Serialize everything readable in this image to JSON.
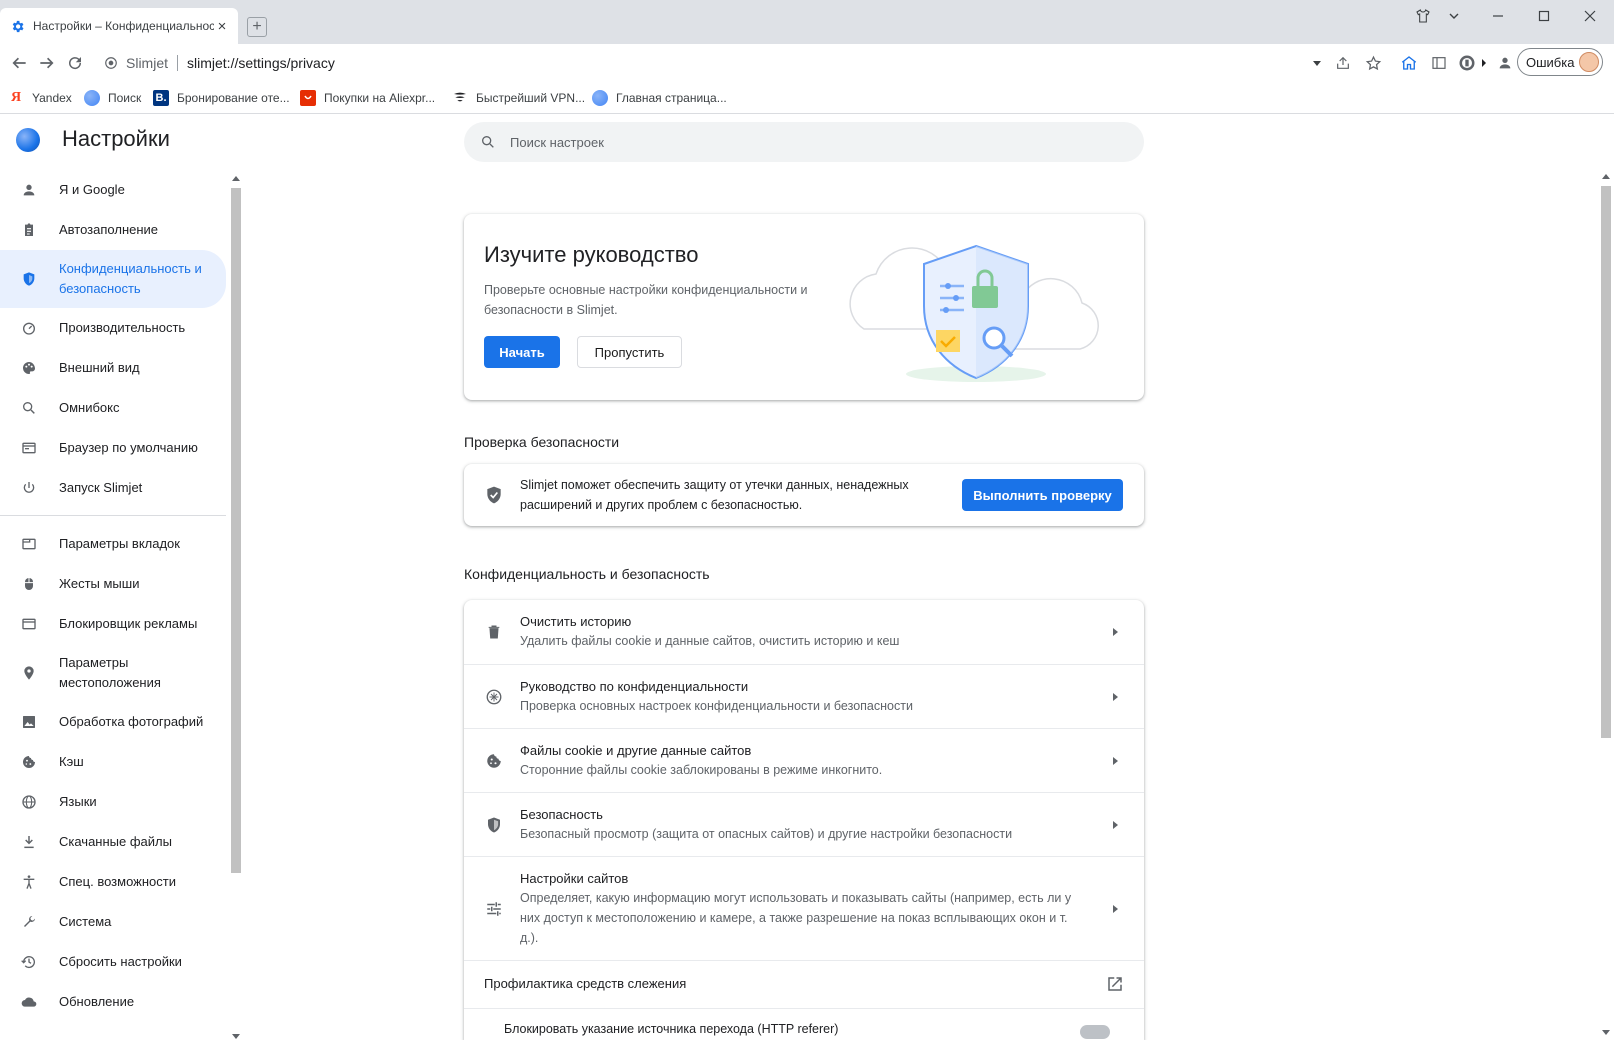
{
  "tab": {
    "title": "Настройки – Конфиденциальность",
    "close": "×",
    "new_tab": "+"
  },
  "toolbar": {
    "site_name": "Slimjet",
    "url": "slimjet://settings/privacy",
    "error_label": "Ошибка"
  },
  "bookmarks": [
    {
      "label": "Yandex",
      "icon": "yandex-icon",
      "color": "#ffffff"
    },
    {
      "label": "Поиск",
      "icon": "globe-icon",
      "color": "#4285f4"
    },
    {
      "label": "Бронирование оте...",
      "icon": "booking-icon",
      "color": "#003580",
      "letter": "B."
    },
    {
      "label": "Покупки на Aliexpr...",
      "icon": "aliexpress-icon",
      "color": "#e62e04"
    },
    {
      "label": "Быстрейший VPN...",
      "icon": "vpn-icon",
      "color": "#202124"
    },
    {
      "label": "Главная страница...",
      "icon": "globe-icon",
      "color": "#4285f4"
    }
  ],
  "header": {
    "title": "Настройки"
  },
  "search": {
    "placeholder": "Поиск настроек"
  },
  "sidebar": {
    "items": [
      {
        "label": "Я и Google",
        "icon": "person-icon"
      },
      {
        "label": "Автозаполнение",
        "icon": "clipboard-icon"
      },
      {
        "label": "Конфиденциальность и безопасность",
        "icon": "shield-icon",
        "active": true
      },
      {
        "label": "Производительность",
        "icon": "speedometer-icon"
      },
      {
        "label": "Внешний вид",
        "icon": "palette-icon"
      },
      {
        "label": "Омнибокс",
        "icon": "search-icon"
      },
      {
        "label": "Браузер по умолчанию",
        "icon": "browser-icon"
      },
      {
        "label": "Запуск Slimjet",
        "icon": "power-icon"
      },
      {
        "label": "Параметры вкладок",
        "icon": "tabs-icon"
      },
      {
        "label": "Жесты мыши",
        "icon": "mouse-icon"
      },
      {
        "label": "Блокировщик рекламы",
        "icon": "adblock-icon"
      },
      {
        "label": "Параметры местоположения",
        "icon": "location-icon"
      },
      {
        "label": "Обработка фотографий",
        "icon": "image-icon"
      },
      {
        "label": "Кэш",
        "icon": "cookie-icon"
      },
      {
        "label": "Языки",
        "icon": "globe-icon"
      },
      {
        "label": "Скачанные файлы",
        "icon": "download-icon"
      },
      {
        "label": "Спец. возможности",
        "icon": "accessibility-icon"
      },
      {
        "label": "Система",
        "icon": "wrench-icon"
      },
      {
        "label": "Сбросить настройки",
        "icon": "history-icon"
      },
      {
        "label": "Обновление",
        "icon": "cloud-icon"
      }
    ]
  },
  "guide": {
    "title": "Изучите руководство",
    "description": "Проверьте основные настройки конфиденциальности и безопасности в Slimjet.",
    "start_label": "Начать",
    "skip_label": "Пропустить"
  },
  "safety_check": {
    "section_title": "Проверка безопасности",
    "description": "Slimjet поможет обеспечить защиту от утечки данных, ненадежных расширений и других проблем с безопасностью.",
    "button_label": "Выполнить проверку"
  },
  "privacy": {
    "section_title": "Конфиденциальность и безопасность",
    "rows": [
      {
        "title": "Очистить историю",
        "subtitle": "Удалить файлы cookie и данные сайтов, очистить историю и кеш",
        "icon": "trash-icon"
      },
      {
        "title": "Руководство по конфиденциальности",
        "subtitle": "Проверка основных настроек конфиденциальности и безопасности",
        "icon": "compass-icon"
      },
      {
        "title": "Файлы cookie и другие данные сайтов",
        "subtitle": "Сторонние файлы cookie заблокированы в режиме инкогнито.",
        "icon": "cookie-icon"
      },
      {
        "title": "Безопасность",
        "subtitle": "Безопасный просмотр (защита от опасных сайтов) и другие настройки безопасности",
        "icon": "shield-icon"
      },
      {
        "title": "Настройки сайтов",
        "subtitle": "Определяет, какую информацию могут использовать и показывать сайты (например, есть ли у них доступ к местоположению и камере, а также разрешение на показ всплывающих окон и т. д.).",
        "icon": "tune-icon"
      }
    ],
    "tracking_label": "Профилактика средств слежения",
    "referer_label": "Блокировать указание источника перехода (HTTP referer)"
  },
  "colors": {
    "accent": "#1a73e8",
    "active_bg": "#e8f0fe",
    "chrome_bg": "#dee1e6"
  }
}
